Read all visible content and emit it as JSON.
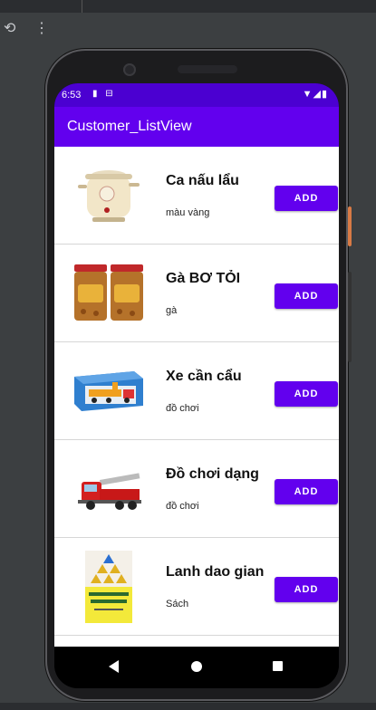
{
  "ide": {
    "rerun_icon": "⟲",
    "more_icon": "⋮"
  },
  "status_bar": {
    "time": "6:53",
    "notification_icons": "▮ ⊟",
    "right_icons": "▼◢▮"
  },
  "app_bar": {
    "title": "Customer_ListView"
  },
  "products": [
    {
      "name": "Ca nấu lẩu",
      "description": "màu vàng",
      "button": "ADD",
      "image": "hot-pot-image"
    },
    {
      "name": "Gà BƠ TỎI",
      "description": "gà",
      "button": "ADD",
      "image": "garlic-chicken-jars-image"
    },
    {
      "name": "Xe cần cẩu",
      "description": "đồ chơi",
      "button": "ADD",
      "image": "crane-truck-toy-image"
    },
    {
      "name": "Đồ chơi dạng mô hình",
      "description": "đồ chơi",
      "button": "ADD",
      "image": "fire-truck-model-image"
    },
    {
      "name": "Lanh dao gian don",
      "description": "Sách",
      "button": "ADD",
      "image": "book-cover-image"
    }
  ],
  "colors": {
    "primary": "#6200ee",
    "primary_dark": "#4b00d1"
  }
}
